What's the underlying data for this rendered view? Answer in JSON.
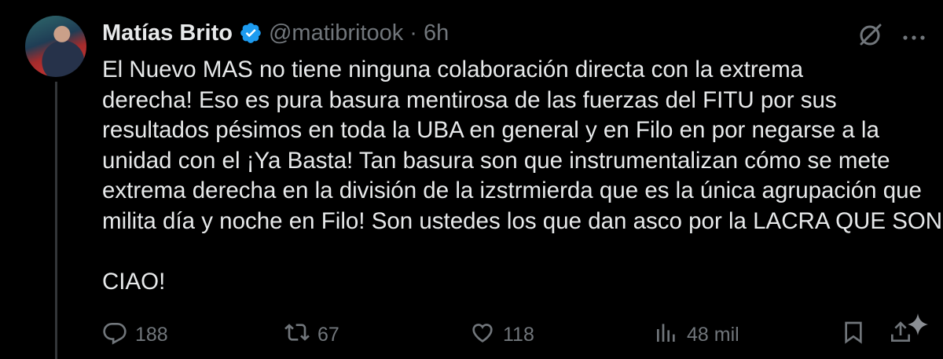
{
  "author": {
    "name": "Matías Brito",
    "handle": "@matibritook",
    "separator": "·",
    "time": "6h"
  },
  "tweet": {
    "lines": [
      "El Nuevo MAS no tiene ninguna colaboración directa con la extrema",
      "derecha! Eso es pura basura mentirosa de las fuerzas del FITU por sus",
      "resultados pésimos en toda la UBA en general y en Filo en  por negarse a la",
      "unidad con el ¡Ya Basta! Tan basura son que instrumentalizan cómo se mete",
      "extrema derecha en la división de la izstrmierda que es la única agrupación que",
      "milita día y noche en Filo!  Son ustedes los que dan asco por la LACRA QUE SON"
    ],
    "closing": "CIAO!"
  },
  "metrics": {
    "replies": "188",
    "reposts": "67",
    "likes": "118",
    "views": "48 mil"
  },
  "icons": {
    "verified": "verified-badge-icon",
    "grok": "grok-icon",
    "more": "more-icon",
    "reply": "reply-icon",
    "repost": "repost-icon",
    "like": "heart-icon",
    "views": "views-icon",
    "bookmark": "bookmark-icon",
    "share": "share-icon",
    "sparkle": "sparkle-icon"
  },
  "colors": {
    "background": "#000000",
    "text": "#e7e9ea",
    "secondary": "#71767b",
    "verified": "#1d9bf0"
  }
}
